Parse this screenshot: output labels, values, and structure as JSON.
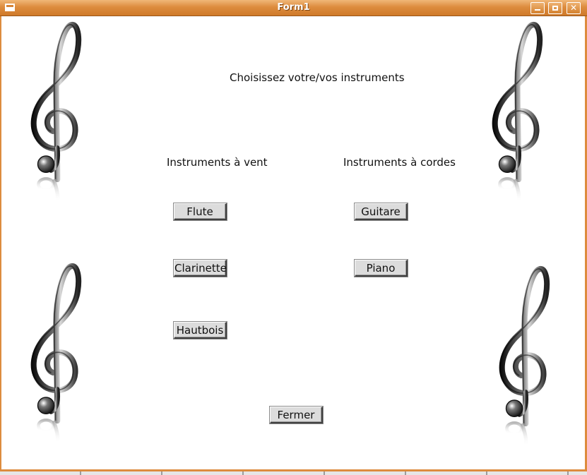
{
  "window": {
    "title": "Form1",
    "controls": [
      "minimize-icon",
      "maximize-icon",
      "close-icon"
    ]
  },
  "labels": {
    "heading": "Choisissez votre/vos instruments",
    "wind_header": "Instruments à vent",
    "string_header": "Instruments à cordes"
  },
  "wind_instruments": [
    "Flute",
    "Clarinette",
    "Hautbois"
  ],
  "string_instruments": [
    "Guitare",
    "Piano"
  ],
  "buttons": {
    "close": "Fermer"
  },
  "decor": {
    "icon": "treble-clef-icon",
    "count": 4
  },
  "colors": {
    "titlebar": "#dd8c3e",
    "button_face": "#dcdcdc",
    "background": "#ffffff"
  }
}
